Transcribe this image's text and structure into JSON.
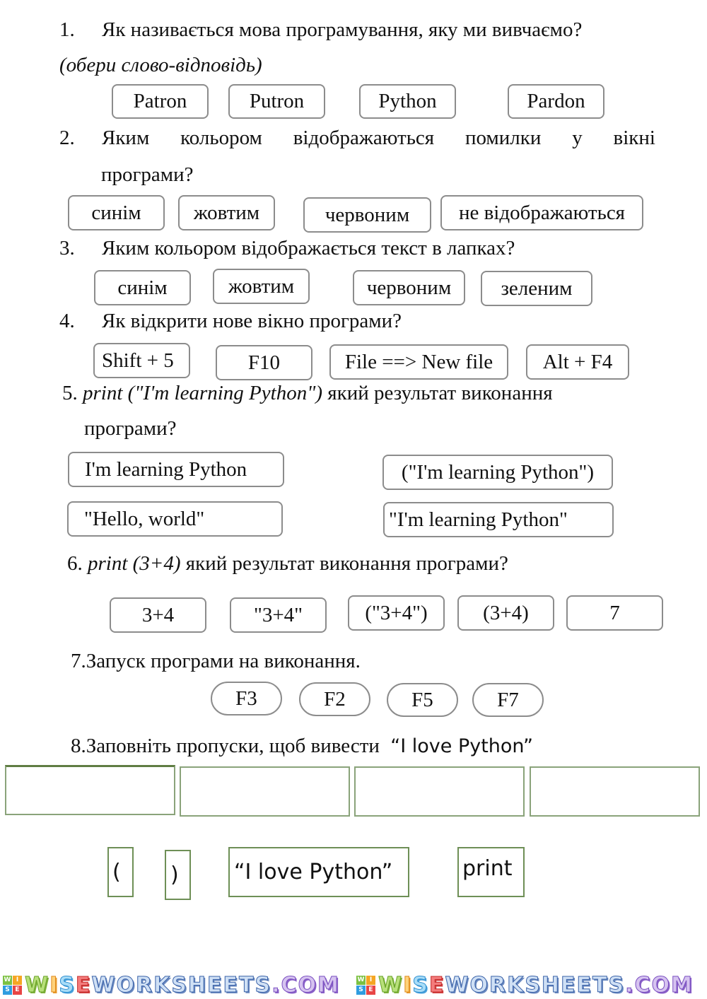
{
  "q1": {
    "number": "1.",
    "text": "Як називається мова програмування, яку ми вивчаємо?",
    "hint": "(обери слово-відповідь)",
    "options": [
      "Patron",
      "Putron",
      "Python",
      "Pardon"
    ]
  },
  "q2": {
    "number": "2.",
    "text_line1": [
      "Яким",
      "кольором",
      "відображаються",
      "помилки",
      "у",
      "вікні"
    ],
    "text_line2": "програми?",
    "options": [
      "синім",
      "жовтим",
      "червоним",
      "не відображаються"
    ]
  },
  "q3": {
    "number": "3.",
    "text": "Яким кольором відображається текст в лапках?",
    "options": [
      "синім",
      "жовтим",
      "червоним",
      "зеленим"
    ]
  },
  "q4": {
    "number": "4.",
    "text": "Як відкрити нове вікно програми?",
    "options": [
      "Shift + 5",
      "F10",
      "File ==> New file",
      "Alt + F4"
    ]
  },
  "q5": {
    "number": "5.",
    "code": "print (\"I'm learning Python\")",
    "text_line1": " який результат виконання",
    "text_line2": "програми?",
    "options": [
      "I'm learning Python",
      "(\"I'm learning Python\")",
      "\"Hello, world\"",
      "\"I'm learning Python\""
    ]
  },
  "q6": {
    "number": "6.",
    "code": "print (3+4)",
    "text": " який результат виконання програми?",
    "options": [
      "3+4",
      "\"3+4\"",
      "(\"3+4\")",
      "(3+4)",
      "7"
    ]
  },
  "q7": {
    "number": "7.",
    "text": "Запуск програми на виконання.",
    "options": [
      "F3",
      "F2",
      "F5",
      "F7"
    ]
  },
  "q8": {
    "number": "8.",
    "text": "Заповніть пропуски, щоб вивести",
    "target": "“I love Python”",
    "slots": [
      "",
      "",
      "",
      ""
    ],
    "cards": [
      "(",
      ")",
      "“I love Python”",
      "print"
    ]
  },
  "footer": {
    "logo_letters": [
      "W",
      "I",
      "S",
      "E"
    ],
    "brand_parts": [
      "W",
      "I",
      "S",
      "E",
      "WORKSHEETS",
      ".COM"
    ]
  }
}
